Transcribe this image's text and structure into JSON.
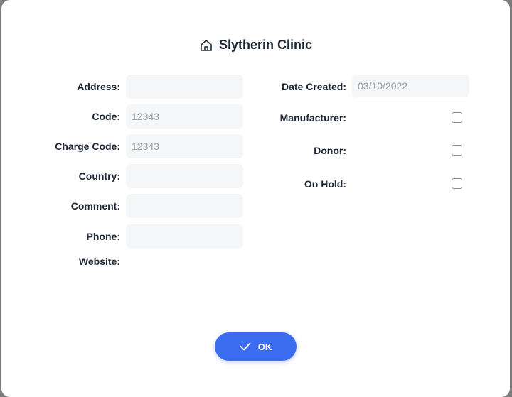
{
  "dialog": {
    "title": "Slytherin Clinic",
    "title_icon": "home-icon"
  },
  "left_fields": [
    {
      "label": "Address:",
      "value": ""
    },
    {
      "label": "Code:",
      "value": "12343"
    },
    {
      "label": "Charge Code:",
      "value": "12343"
    },
    {
      "label": "Country:",
      "value": ""
    },
    {
      "label": "Comment:",
      "value": ""
    },
    {
      "label": "Phone:",
      "value": ""
    },
    {
      "label": "Website:",
      "value": ""
    }
  ],
  "right_fields": {
    "date_created": {
      "label": "Date Created:",
      "value": "03/10/2022"
    },
    "manufacturer": {
      "label": "Manufacturer:",
      "checked": false
    },
    "donor": {
      "label": "Donor:",
      "checked": false
    },
    "on_hold": {
      "label": "On Hold:",
      "checked": false
    }
  },
  "actions": {
    "ok_label": "OK",
    "ok_icon": "checkmark-icon"
  },
  "colors": {
    "accent": "#3b6cf0",
    "field_bg": "#f5f6f8"
  }
}
